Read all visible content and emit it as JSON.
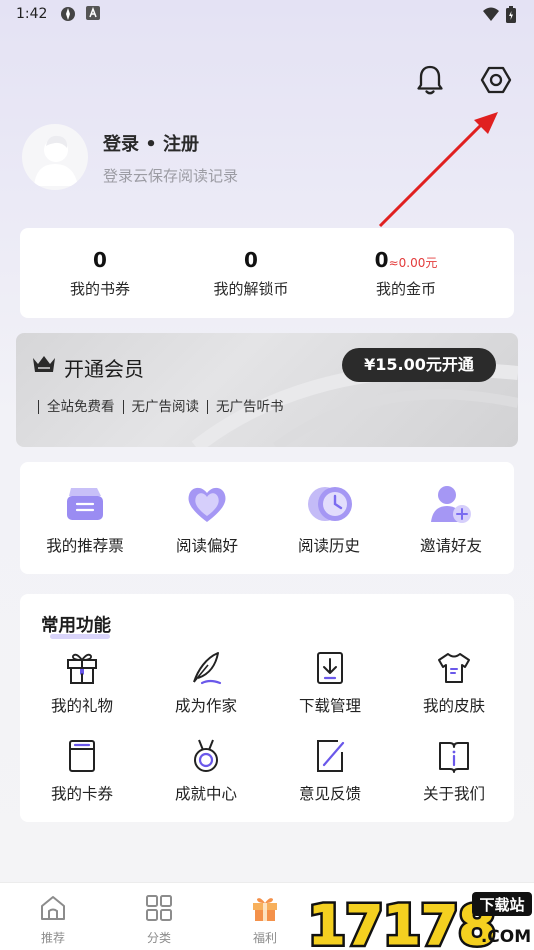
{
  "status_bar": {
    "time": "1:42"
  },
  "profile": {
    "title": "登录 • 注册",
    "subtitle": "登录云保存阅读记录"
  },
  "assets": [
    {
      "num": "0",
      "label": "我的书券",
      "sub": ""
    },
    {
      "num": "0",
      "label": "我的解锁币",
      "sub": ""
    },
    {
      "num": "0",
      "label": "我的金币",
      "sub": "≈0.00元"
    }
  ],
  "vip": {
    "title": "开通会员",
    "button": "¥15.00元开通",
    "benefits": [
      "全站免费看",
      "无广告阅读",
      "无广告听书"
    ]
  },
  "quick_actions": [
    {
      "label": "我的推荐票",
      "icon": "ticket-icon"
    },
    {
      "label": "阅读偏好",
      "icon": "heart-icon"
    },
    {
      "label": "阅读历史",
      "icon": "clock-icon"
    },
    {
      "label": "邀请好友",
      "icon": "invite-friend-icon"
    }
  ],
  "tools": {
    "title": "常用功能",
    "items": [
      {
        "label": "我的礼物",
        "icon": "gift-icon"
      },
      {
        "label": "成为作家",
        "icon": "quill-icon"
      },
      {
        "label": "下载管理",
        "icon": "download-icon"
      },
      {
        "label": "我的皮肤",
        "icon": "tshirt-icon"
      },
      {
        "label": "我的卡券",
        "icon": "card-icon"
      },
      {
        "label": "成就中心",
        "icon": "medal-icon"
      },
      {
        "label": "意见反馈",
        "icon": "feedback-icon"
      },
      {
        "label": "关于我们",
        "icon": "info-book-icon"
      }
    ]
  },
  "bottom_nav": [
    {
      "label": "推荐",
      "icon": "home-icon"
    },
    {
      "label": "分类",
      "icon": "grid-icon"
    },
    {
      "label": "福利",
      "icon": "gift-icon"
    }
  ],
  "watermark": {
    "text": "17178",
    "domain": ".COM",
    "tag": "下载站"
  },
  "colors": {
    "accent": "#7b6cf0",
    "price_red": "#e33b3b",
    "vip_button": "#2b2b2b"
  }
}
